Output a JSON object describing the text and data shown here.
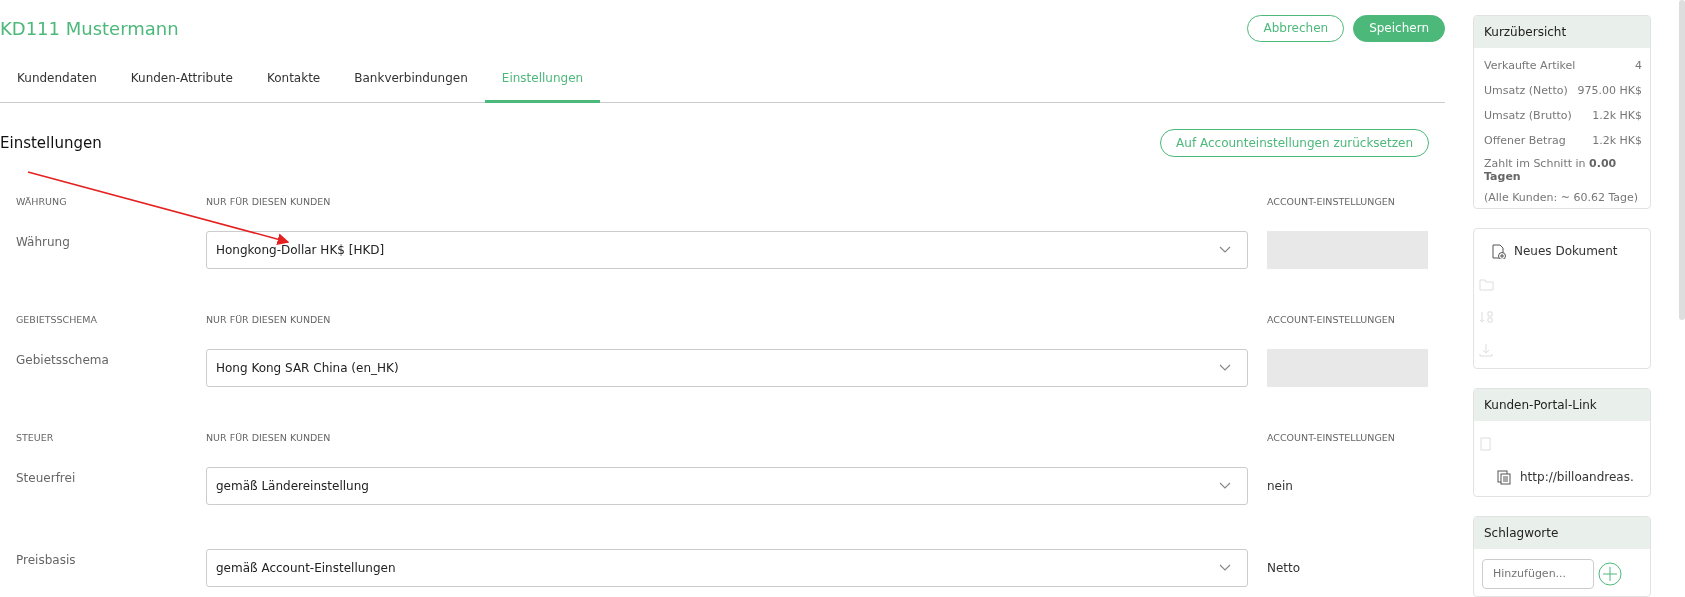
{
  "header": {
    "title": "KD111 Mustermann",
    "buttons": [
      {
        "label": "Abbrechen",
        "kind": "outline"
      },
      {
        "label": "Speichern",
        "kind": "primary"
      }
    ]
  },
  "tabs": [
    {
      "label": "Kundendaten",
      "selected": false
    },
    {
      "label": "Kunden-Attribute",
      "selected": false
    },
    {
      "label": "Kontakte",
      "selected": false
    },
    {
      "label": "Bankverbindungen",
      "selected": false
    },
    {
      "label": "Einstellungen",
      "selected": true
    }
  ],
  "section": {
    "title": "Einstellungen",
    "reset_button": "Auf Accounteinstellungen zurücksetzen"
  },
  "groups": [
    {
      "heading": "WÄHRUNG",
      "column_2": "NUR FÜR DIESEN KUNDEN",
      "column_3": "ACCOUNT-EINSTELLUNGEN",
      "fields": [
        {
          "label": "Währung",
          "value": "Hongkong-Dollar HK$ [HKD]"
        }
      ]
    },
    {
      "heading": "GEBIETSSCHEMA",
      "column_2": "NUR FÜR DIESEN KUNDEN",
      "column_3": "ACCOUNT-EINSTELLUNGEN",
      "fields": [
        {
          "label": "Gebietsschema",
          "value": "Hong Kong SAR China (en_HK)"
        }
      ]
    },
    {
      "heading": "STEUER",
      "column_2": "NUR FÜR DIESEN KUNDEN",
      "column_3": "ACCOUNT-EINSTELLUNGEN",
      "fields": [
        {
          "label": "Steuerfrei",
          "value": "gemäß Ländereinstellung",
          "account": "nein"
        },
        {
          "label": "Preisbasis",
          "value": "gemäß Account-Einstellungen",
          "account": "Netto"
        }
      ]
    }
  ],
  "sidebar": {
    "overview": {
      "title": "Kurzübersicht",
      "rows": [
        {
          "label": "Verkaufte Artikel",
          "value": "4"
        },
        {
          "label": "Umsatz (Netto)",
          "value": "975.00 HK$"
        },
        {
          "label": "Umsatz (Brutto)",
          "value": "1.2k HK$"
        },
        {
          "label": "Offener Betrag",
          "value": "1.2k HK$"
        }
      ],
      "note": "Zahlt im Schnitt in **0.00 Tagen**",
      "note_2": "(Alle Kunden: ~ 60.62 Tage)"
    },
    "actions": [
      {
        "label": "Neues Dokument"
      }
    ],
    "portal": {
      "title": "Kunden-Portal-Link",
      "link": "http://billoandreas."
    },
    "tags": {
      "title": "Schlagworte",
      "placeholder": "Hinzufügen..."
    }
  }
}
